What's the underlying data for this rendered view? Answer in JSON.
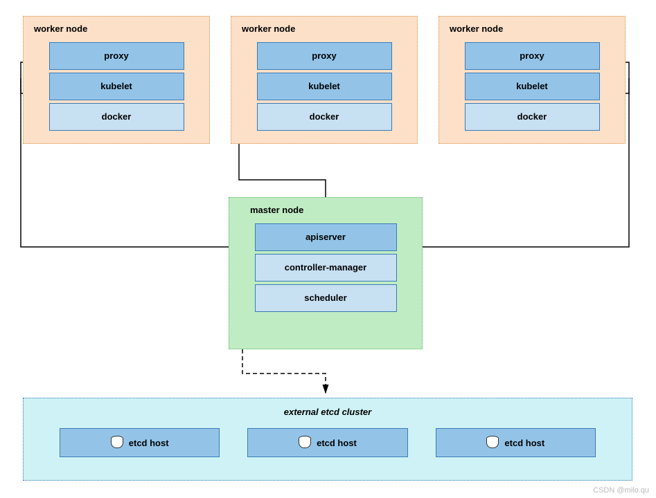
{
  "workers": [
    {
      "title": "worker node",
      "components": {
        "proxy": "proxy",
        "kubelet": "kubelet",
        "docker": "docker"
      }
    },
    {
      "title": "worker node",
      "components": {
        "proxy": "proxy",
        "kubelet": "kubelet",
        "docker": "docker"
      }
    },
    {
      "title": "worker node",
      "components": {
        "proxy": "proxy",
        "kubelet": "kubelet",
        "docker": "docker"
      }
    }
  ],
  "master": {
    "title": "master node",
    "components": {
      "apiserver": "apiserver",
      "controller_manager": "controller-manager",
      "scheduler": "scheduler"
    }
  },
  "etcd": {
    "title": "external etcd cluster",
    "hosts": [
      {
        "label": "etcd host"
      },
      {
        "label": "etcd host"
      },
      {
        "label": "etcd host"
      }
    ]
  },
  "watermark": "CSDN @milo.qu"
}
